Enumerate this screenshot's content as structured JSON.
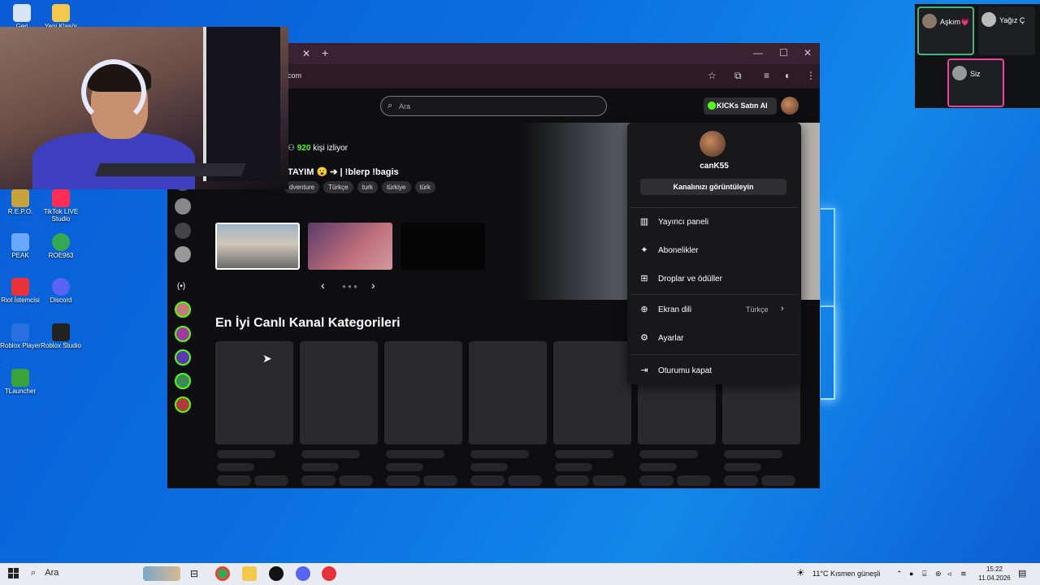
{
  "desktop": {
    "icons": [
      {
        "label": "Geri",
        "color": "#d6e4f5"
      },
      {
        "label": "Yeni Klasör",
        "color": "#f4c84a"
      },
      {
        "label": "R.E.P.O.",
        "color": "#c8a23a"
      },
      {
        "label": "TikTok LIVE Studio",
        "color": "#ff2d55"
      },
      {
        "label": "PEAK",
        "color": "#6aa8ff"
      },
      {
        "label": "ROE963",
        "color": "#34a853"
      },
      {
        "label": "Riot İstemcisi",
        "color": "#e8323a"
      },
      {
        "label": "Discord",
        "color": "#5865f2"
      },
      {
        "label": "Roblox Player",
        "color": "#2a6fe0"
      },
      {
        "label": "Roblox Studio",
        "color": "#222222"
      },
      {
        "label": "TLauncher",
        "color": "#3aa33a"
      }
    ]
  },
  "browser": {
    "url_suffix": "com",
    "header": {
      "search_placeholder": "Ara",
      "kicks_button": "KICKs Satın Al"
    },
    "stream": {
      "viewer_count": "920",
      "viewer_label": "kişi izliyor",
      "title": "TAYIM 😮 ➔ | !blerp !bagis",
      "tags": [
        "dventure",
        "Türkçe",
        "turk",
        "türkiye",
        "türk"
      ]
    },
    "section_title": "En İyi Canlı Kanal Kategorileri",
    "dropdown": {
      "username": "canK55",
      "channel_button": "Kanalınızı görüntüleyin",
      "items": [
        {
          "label": "Yayıncı paneli",
          "icon": "chart-icon"
        },
        {
          "label": "Abonelikler",
          "icon": "sparkle-icon"
        },
        {
          "label": "Droplar ve ödüller",
          "icon": "gift-icon"
        },
        {
          "label": "Ekran dili",
          "value": "Türkçe",
          "icon": "globe-icon"
        },
        {
          "label": "Ayarlar",
          "icon": "gear-icon"
        },
        {
          "label": "Oturumu kapat",
          "icon": "logout-icon"
        }
      ]
    }
  },
  "call": {
    "participants": [
      "Aşkım💗",
      "Yağız Ç",
      "Siz"
    ]
  },
  "taskbar": {
    "search_placeholder": "Ara",
    "weather": "11°C  Kısmen güneşli",
    "time": "15:22",
    "date": "11.04.2026"
  },
  "colors": {
    "kick_green": "#53fc18",
    "dropdown_bg": "#18181b",
    "speaking_border": "#43b581",
    "self_border": "#eb459e"
  }
}
